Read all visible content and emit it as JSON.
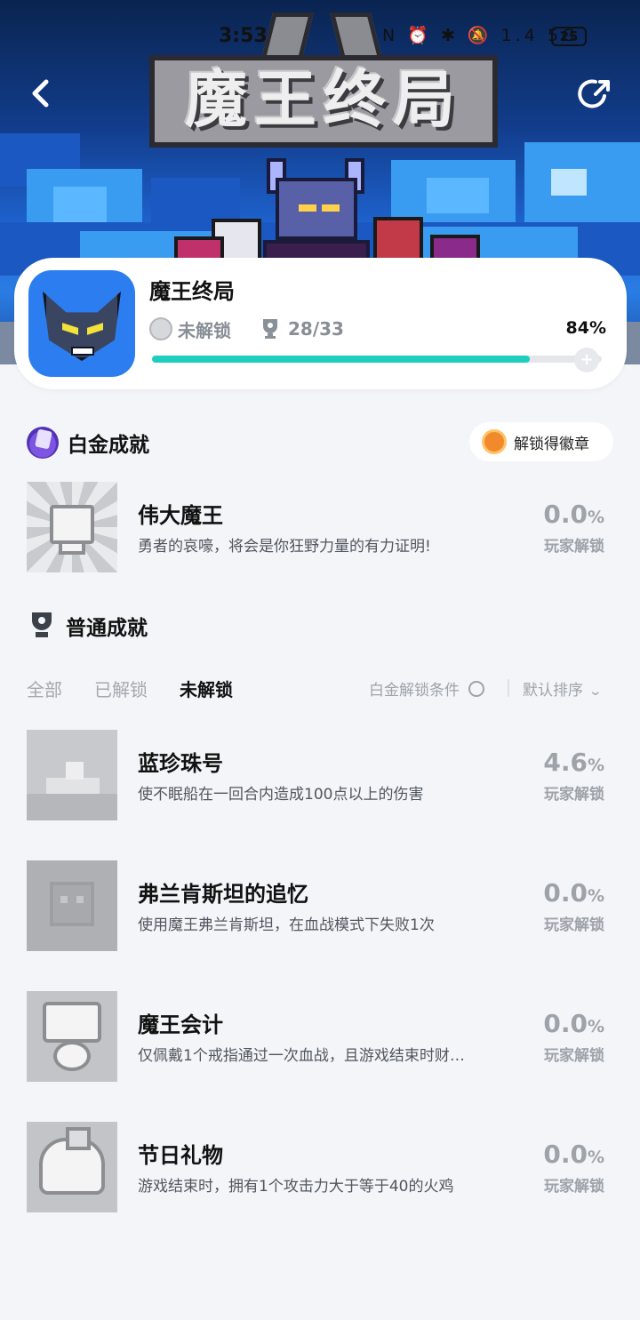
{
  "status_bar": {
    "time": "3:53",
    "icons": "N ⏰ ✱ 🔕 1.4 5G",
    "battery": "25"
  },
  "header": {
    "logo_text": "魔王终局",
    "back_icon": "chevron-left-icon",
    "share_icon": "share-icon"
  },
  "game": {
    "name": "魔王终局",
    "platinum_state": "未解锁",
    "trophy_count": "28/33",
    "progress_percent": "84%",
    "progress_value": 0.84
  },
  "platinum_section": {
    "title": "白金成就",
    "badge_button": "解锁得徽章",
    "item": {
      "title": "伟大魔王",
      "desc": "勇者的哀嚎，将会是你狂野力量的有力证明!",
      "rate": "0.0",
      "rate_unit": "%",
      "rate_label": "玩家解锁"
    }
  },
  "normal_section": {
    "title": "普通成就",
    "tabs": [
      "全部",
      "已解锁",
      "未解锁"
    ],
    "active_tab": "未解锁",
    "condition_label": "白金解锁条件",
    "sort_label": "默认排序",
    "items": [
      {
        "title": "蓝珍珠号",
        "desc": "使不眠船在一回合内造成100点以上的伤害",
        "rate": "4.6",
        "rate_unit": "%",
        "rate_label": "玩家解锁"
      },
      {
        "title": "弗兰肯斯坦的追忆",
        "desc": "使用魔王弗兰肯斯坦，在血战模式下失败1次",
        "rate": "0.0",
        "rate_unit": "%",
        "rate_label": "玩家解锁"
      },
      {
        "title": "魔王会计",
        "desc": "仅佩戴1个戒指通过一次血战，且游戏结束时财…",
        "rate": "0.0",
        "rate_unit": "%",
        "rate_label": "玩家解锁"
      },
      {
        "title": "节日礼物",
        "desc": "游戏结束时，拥有1个攻击力大于等于40的火鸡",
        "rate": "0.0",
        "rate_unit": "%",
        "rate_label": "玩家解锁"
      }
    ]
  },
  "colors": {
    "progress": "#1ecfc0",
    "page_bg": "#f3f5f8",
    "hero_blue": "#1e63cf"
  }
}
